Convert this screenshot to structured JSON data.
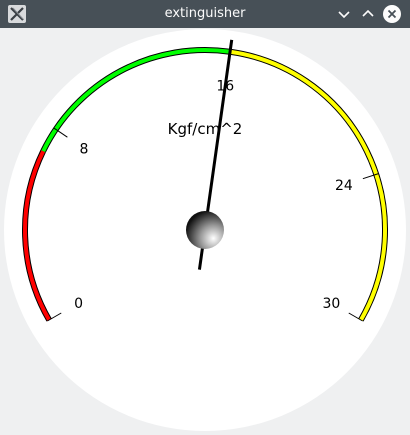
{
  "window": {
    "title": "extinguisher",
    "app_icon": "x-app-icon",
    "controls": {
      "minimize_icon": "chevron-down-icon",
      "maximize_icon": "chevron-up-icon",
      "close_icon": "close-icon"
    }
  },
  "gauge": {
    "unit": "Kgf/cm^2",
    "min": 0,
    "max": 30,
    "value": 16,
    "ticks": [
      {
        "value": 0,
        "label": "0"
      },
      {
        "value": 8,
        "label": "8"
      },
      {
        "value": 16,
        "label": "16"
      },
      {
        "value": 24,
        "label": "24"
      },
      {
        "value": 30,
        "label": "30"
      }
    ],
    "zones": [
      {
        "from": 0,
        "to": 7,
        "color": "#ff0000"
      },
      {
        "from": 7,
        "to": 16,
        "color": "#00ff00"
      },
      {
        "from": 16,
        "to": 30,
        "color": "#ffff00"
      }
    ],
    "colors": {
      "face": "#ffffff",
      "needle": "#000000",
      "titlebar": "#475057",
      "background": "#eff0f1"
    }
  }
}
